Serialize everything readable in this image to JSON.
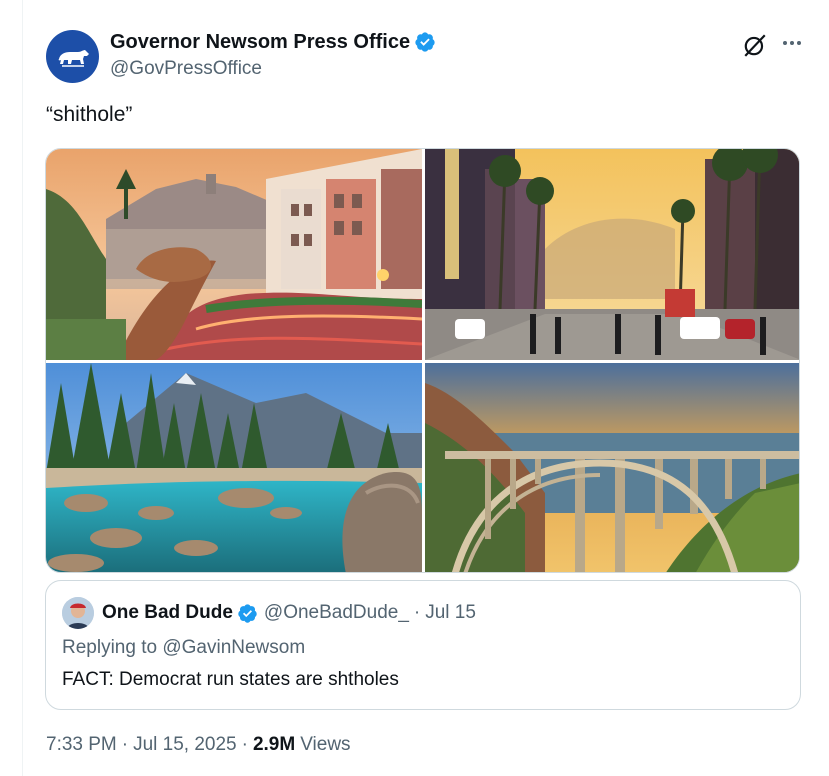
{
  "tweet": {
    "author_name": "Governor Newsom Press Office",
    "author_handle": "@GovPressOffice",
    "text": "“shithole”",
    "verified": true,
    "icons": [
      "california-bear-avatar",
      "verified-badge-icon",
      "grok-icon",
      "more-icon"
    ]
  },
  "media": {
    "images": [
      {
        "label": "san-francisco-lombard-street-photo"
      },
      {
        "label": "hollywood-boulevard-palm-trees-photo"
      },
      {
        "label": "lake-tahoe-clear-water-photo"
      },
      {
        "label": "bixby-bridge-big-sur-photo"
      }
    ]
  },
  "quoted": {
    "author_name": "One Bad Dude",
    "author_handle": "@OneBadDude_",
    "separator": "·",
    "date": "Jul 15",
    "replying_to": "Replying to @GavinNewsom",
    "text": "FACT: Democrat run states are shtholes"
  },
  "meta": {
    "time": "7:33 PM",
    "date": "Jul 15, 2025",
    "separator": "·",
    "views_count": "2.9M",
    "views_label": "Views"
  },
  "colors": {
    "verified_blue": "#1d9bf0",
    "secondary_text": "#536471",
    "primary_text": "#0f1419",
    "border": "#cfd9de"
  }
}
